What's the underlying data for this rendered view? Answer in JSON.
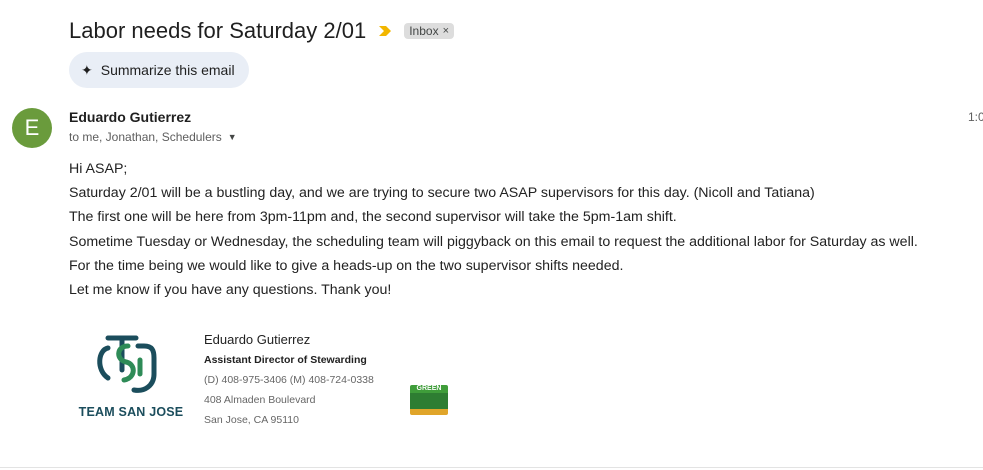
{
  "email": {
    "subject": "Labor needs for Saturday 2/01",
    "label": "Inbox",
    "label_remove": "×",
    "summarize_label": "Summarize this email",
    "avatar_letter": "E",
    "sender": "Eduardo Gutierrez",
    "recipients": "to me, Jonathan, Schedulers",
    "time": "1:0",
    "body": [
      "Hi ASAP;",
      "Saturday 2/01 will be a bustling day, and we are trying to secure two ASAP supervisors for this day. (Nicoll and Tatiana)",
      "The first one will be here from 3pm-11pm and, the second supervisor will take the 5pm-1am shift.",
      "Sometime Tuesday or Wednesday, the scheduling team will piggyback on this email to request the additional labor for Saturday as well.",
      "For the time being we would like to give a heads-up on the two supervisor shifts needed.",
      "Let me know if you have any questions. Thank you!"
    ]
  },
  "signature": {
    "logo_text": "TEAM SAN JOSE",
    "name": "Eduardo Gutierrez",
    "title": "Assistant Director of Stewarding",
    "phones": "(D) 408-975-3406 (M) 408-724-0338",
    "address1": "408 Almaden Boulevard",
    "address2": "San Jose, CA 95110",
    "badge_text": "GREEN"
  },
  "colors": {
    "avatar": "#6a9b3c",
    "importance": "#f2b600",
    "logo_teal": "#1b4d5c",
    "logo_green": "#2e8b57",
    "badge_green": "#3f9d3a",
    "badge_gold": "#e0a52a"
  },
  "icons": {
    "importance": "importance-marker-icon",
    "summarize": "sparkle-icon",
    "recipients_toggle": "caret-down-icon"
  }
}
